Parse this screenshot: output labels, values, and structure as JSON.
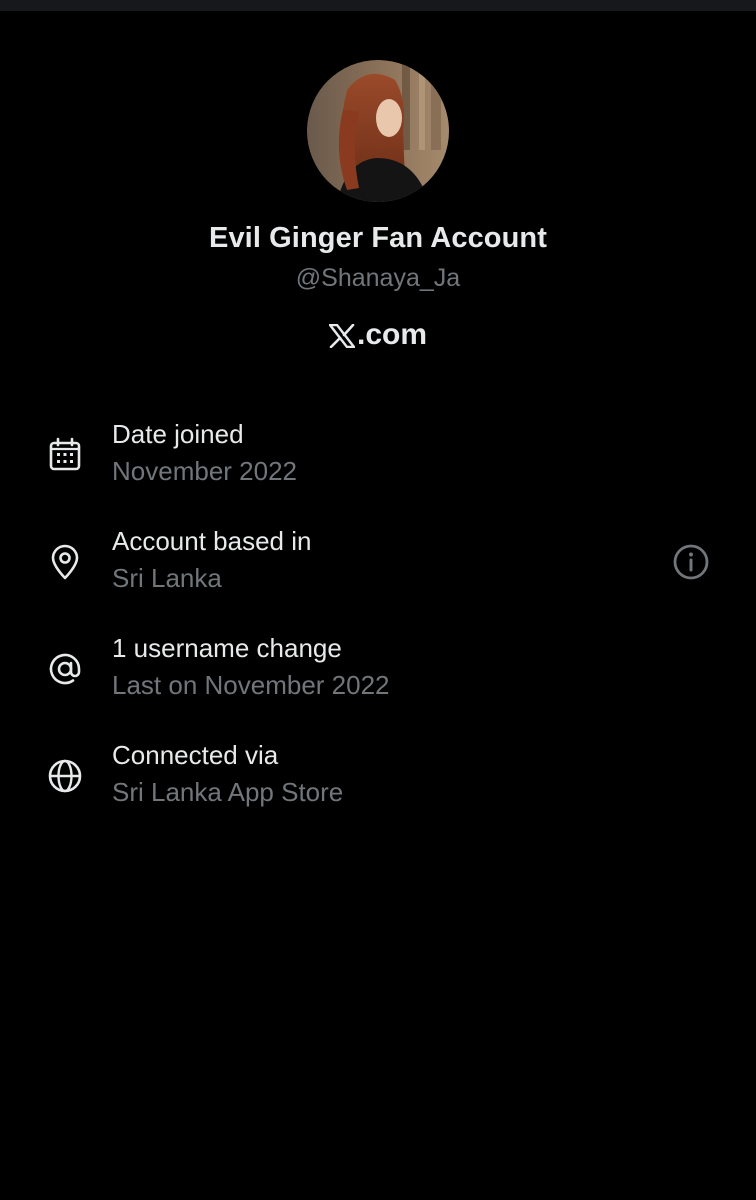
{
  "profile": {
    "display_name": "Evil Ginger Fan Account",
    "handle": "@Shanaya_Ja",
    "avatar": "profile-photo"
  },
  "brand": {
    "logo_icon": "x-logo-icon",
    "suffix": ".com"
  },
  "details": [
    {
      "icon": "calendar-icon",
      "title": "Date joined",
      "value": "November 2022"
    },
    {
      "icon": "location-pin-icon",
      "title": "Account based in",
      "value": "Sri Lanka",
      "action_icon": "info-icon"
    },
    {
      "icon": "at-sign-icon",
      "title": "1 username change",
      "value": "Last on November 2022"
    },
    {
      "icon": "globe-icon",
      "title": "Connected via",
      "value": "Sri Lanka App Store"
    }
  ],
  "colors": {
    "background": "#000000",
    "primary_text": "#e7e9ea",
    "secondary_text": "#71767b",
    "status_bar": "#16181c"
  }
}
